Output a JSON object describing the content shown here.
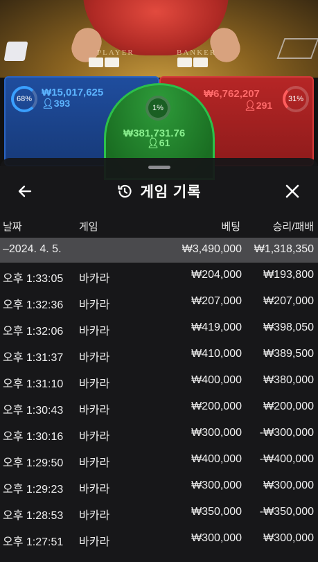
{
  "table": {
    "player_label": "PLAYER",
    "banker_label": "BANKER"
  },
  "bets": {
    "player": {
      "percent": "68%",
      "amount": "₩15,017,625",
      "count": "393"
    },
    "tie": {
      "percent": "1%",
      "amount": "₩381,731.76",
      "count": "61"
    },
    "banker": {
      "percent": "31%",
      "amount": "₩6,762,207",
      "count": "291"
    }
  },
  "sheet": {
    "title": "게임 기록",
    "back_icon": "arrow-left-icon",
    "history_icon": "history-icon",
    "close_icon": "close-icon"
  },
  "columns": {
    "date": "날짜",
    "game": "게임",
    "bet": "베팅",
    "result": "승리/패배"
  },
  "summary": {
    "date": "–2024. 4. 5.",
    "bet": "₩3,490,000",
    "result": "₩1,318,350"
  },
  "rows": [
    {
      "time": "오후 1:33:05",
      "game": "바카라",
      "bet": "₩204,000",
      "result": "₩193,800"
    },
    {
      "time": "오후 1:32:36",
      "game": "바카라",
      "bet": "₩207,000",
      "result": "₩207,000"
    },
    {
      "time": "오후 1:32:06",
      "game": "바카라",
      "bet": "₩419,000",
      "result": "₩398,050"
    },
    {
      "time": "오후 1:31:37",
      "game": "바카라",
      "bet": "₩410,000",
      "result": "₩389,500"
    },
    {
      "time": "오후 1:31:10",
      "game": "바카라",
      "bet": "₩400,000",
      "result": "₩380,000"
    },
    {
      "time": "오후 1:30:43",
      "game": "바카라",
      "bet": "₩200,000",
      "result": "₩200,000"
    },
    {
      "time": "오후 1:30:16",
      "game": "바카라",
      "bet": "₩300,000",
      "result": "-₩300,000"
    },
    {
      "time": "오후 1:29:50",
      "game": "바카라",
      "bet": "₩400,000",
      "result": "-₩400,000"
    },
    {
      "time": "오후 1:29:23",
      "game": "바카라",
      "bet": "₩300,000",
      "result": "₩300,000"
    },
    {
      "time": "오후 1:28:53",
      "game": "바카라",
      "bet": "₩350,000",
      "result": "-₩350,000"
    },
    {
      "time": "오후 1:27:51",
      "game": "바카라",
      "bet": "₩300,000",
      "result": "₩300,000"
    }
  ],
  "colors": {
    "player": "#1f4d9e",
    "banker": "#b62626",
    "tie": "#2e9b3a",
    "summary_row": "#4a4a4d"
  }
}
